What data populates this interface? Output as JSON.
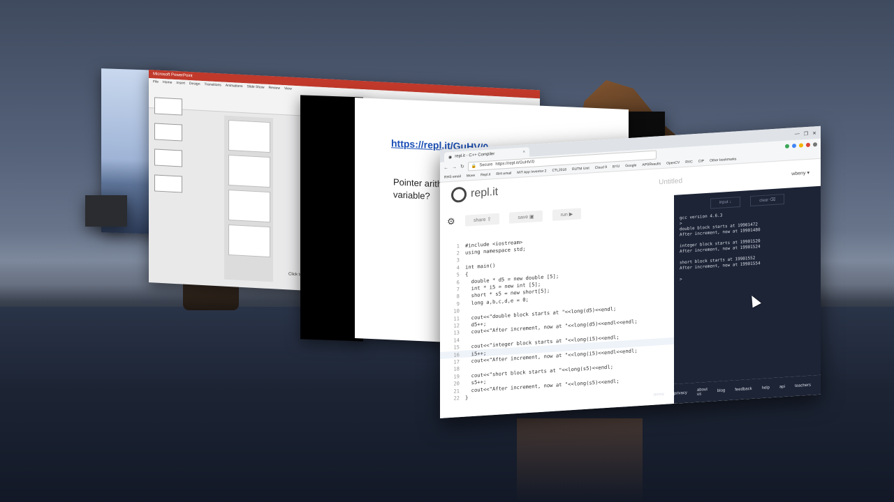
{
  "slide": {
    "link": "https://repl.it/GuHV/0",
    "text": "Pointer arith variable?",
    "click_hint": "Click to add t"
  },
  "ppt": {
    "tabs": [
      "File",
      "Home",
      "Insert",
      "Design",
      "Transitions",
      "Animations",
      "Slide Show",
      "Review",
      "View"
    ],
    "title": "Microsoft PowerPoint"
  },
  "browser": {
    "tab_title": "repl.it - C++ Compiler",
    "tab_close": "×",
    "window_controls": [
      "—",
      "❐",
      "✕"
    ],
    "secure_label": "Secure",
    "url": "https://repl.it/GuHV/0",
    "bookmarks": [
      "RHS email",
      "Move",
      "Repl.it",
      "RHI email",
      "MIT App Inventor 2",
      "CTL2018",
      "RUTM Unit",
      "Cloud 9",
      "BYU",
      "Google",
      "APSResults",
      "OpenCV",
      "RVC",
      "CIP",
      "Other bookmarks"
    ]
  },
  "site": {
    "logo": "repl.it",
    "title_placeholder": "Untitled",
    "user": "wbeny ▾",
    "share": "share ⇪",
    "save": "save ▣",
    "run": "run ▶",
    "input": "input ↓",
    "clear": "clear ⌫",
    "footer_links": [
      "terms",
      "privacy",
      "about us",
      "blog",
      "feedback",
      "help",
      "api",
      "teachers"
    ]
  },
  "code": [
    {
      "n": "1",
      "t": "#include <iostream>"
    },
    {
      "n": "2",
      "t": "using namespace std;"
    },
    {
      "n": "3",
      "t": ""
    },
    {
      "n": "4",
      "t": "int main()"
    },
    {
      "n": "5",
      "t": "{"
    },
    {
      "n": "6",
      "t": "  double * d5 = new double [5];"
    },
    {
      "n": "7",
      "t": "  int * i5 = new int [5];"
    },
    {
      "n": "8",
      "t": "  short * s5 = new short[5];"
    },
    {
      "n": "9",
      "t": "  long a,b,c,d,e = 0;"
    },
    {
      "n": "10",
      "t": ""
    },
    {
      "n": "11",
      "t": "  cout<<\"double block starts at \"<<long(d5)<<endl;"
    },
    {
      "n": "12",
      "t": "  d5++;"
    },
    {
      "n": "13",
      "t": "  cout<<\"After increment, now at \"<<long(d5)<<endl<<endl;"
    },
    {
      "n": "14",
      "t": ""
    },
    {
      "n": "15",
      "t": "  cout<<\"integer block starts at \"<<long(i5)<<endl;"
    },
    {
      "n": "16",
      "t": "  i5++;"
    },
    {
      "n": "17",
      "t": "  cout<<\"After increment, now at \"<<long(i5)<<endl<<endl;"
    },
    {
      "n": "18",
      "t": ""
    },
    {
      "n": "19",
      "t": "  cout<<\"short block starts at \"<<long(s5)<<endl;"
    },
    {
      "n": "20",
      "t": "  s5++;"
    },
    {
      "n": "21",
      "t": "  cout<<\"After increment, now at \"<<long(s5)<<endl;"
    },
    {
      "n": "22",
      "t": "}"
    }
  ],
  "console": {
    "lines": [
      "gcc version 4.6.3",
      "> ",
      "double block starts at 19901472",
      "After increment, now at 19901480",
      "",
      "integer block starts at 19901520",
      "After increment, now at 19901524",
      "",
      "short block starts at 19901552",
      "After increment, now at 19901554",
      "",
      "> "
    ]
  },
  "colors": {
    "console_bg": "#1d2436",
    "ppt_accent": "#c0392b",
    "link": "#1a4fb5"
  }
}
